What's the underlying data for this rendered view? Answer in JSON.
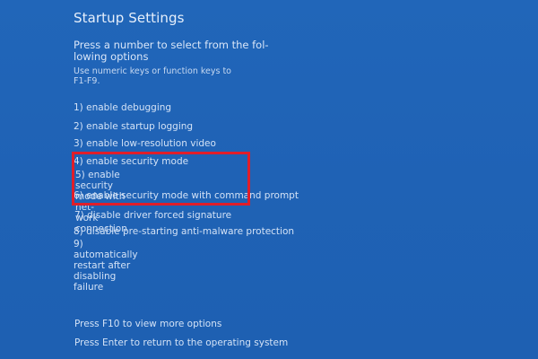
{
  "screen": {
    "title": "Startup Settings",
    "subtitle": "Press a number to select from the fol-\nlowing options",
    "hint": "Use numeric keys or function keys to\nF1-F9."
  },
  "options": [
    {
      "label": "1) enable debugging"
    },
    {
      "label": "2) enable startup logging"
    },
    {
      "label": "3) enable low-resolution video"
    },
    {
      "label": "4) enable security mode"
    },
    {
      "label": "5) enable security mode with net-\nwork connection"
    },
    {
      "label": "6) enable security mode with command prompt"
    },
    {
      "label": "7) disable driver forced signature"
    },
    {
      "label": "8) disable pre-starting anti-malware protection"
    },
    {
      "label": "9) automatically restart after disabling\nfailure"
    }
  ],
  "footer": {
    "more_options": "Press F10 to view more options",
    "return": "Press Enter to return to the operating system"
  },
  "colors": {
    "background": "#1f63b6",
    "highlight_border": "#e01e2a",
    "text": "#d3e2f6"
  }
}
